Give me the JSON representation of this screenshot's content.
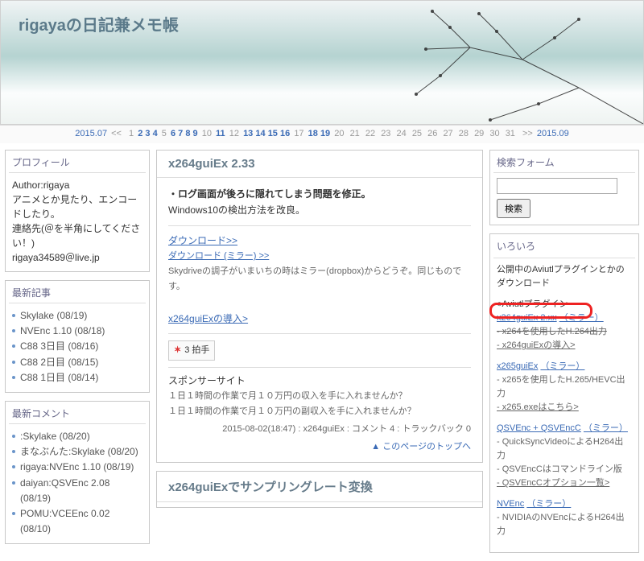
{
  "site_title": "rigayaの日記兼メモ帳",
  "calendar": {
    "prev": "2015.07",
    "next": "2015.09",
    "prev_sym": "<<",
    "next_sym": ">>",
    "days": [
      {
        "n": "1",
        "a": false
      },
      {
        "n": "2",
        "a": true
      },
      {
        "n": "3",
        "a": true
      },
      {
        "n": "4",
        "a": true
      },
      {
        "n": "5",
        "a": false
      },
      {
        "n": "6",
        "a": true
      },
      {
        "n": "7",
        "a": true
      },
      {
        "n": "8",
        "a": true
      },
      {
        "n": "9",
        "a": true
      },
      {
        "n": "10",
        "a": false
      },
      {
        "n": "11",
        "a": true
      },
      {
        "n": "12",
        "a": false
      },
      {
        "n": "13",
        "a": true
      },
      {
        "n": "14",
        "a": true
      },
      {
        "n": "15",
        "a": true
      },
      {
        "n": "16",
        "a": true
      },
      {
        "n": "17",
        "a": false
      },
      {
        "n": "18",
        "a": true
      },
      {
        "n": "19",
        "a": true
      },
      {
        "n": "20",
        "a": false
      },
      {
        "n": "21",
        "a": false
      },
      {
        "n": "22",
        "a": false
      },
      {
        "n": "23",
        "a": false
      },
      {
        "n": "24",
        "a": false
      },
      {
        "n": "25",
        "a": false
      },
      {
        "n": "26",
        "a": false
      },
      {
        "n": "27",
        "a": false
      },
      {
        "n": "28",
        "a": false
      },
      {
        "n": "29",
        "a": false
      },
      {
        "n": "30",
        "a": false
      },
      {
        "n": "31",
        "a": false
      }
    ]
  },
  "profile": {
    "heading": "プロフィール",
    "author_label": "Author:",
    "author": "rigaya",
    "line1": "アニメとか見たり、エンコードしたり。",
    "line2": "連絡先(＠を半角にしてください！)",
    "email": "rigaya34589＠live.jp"
  },
  "recent_posts": {
    "heading": "最新記事",
    "items": [
      "Skylake (08/19)",
      "NVEnc 1.10 (08/18)",
      "C88 3日目 (08/16)",
      "C88 2日目 (08/15)",
      "C88 1日目 (08/14)"
    ]
  },
  "recent_comments": {
    "heading": "最新コメント",
    "items": [
      ":Skylake (08/20)",
      "まなぶんた:Skylake (08/20)",
      "rigaya:NVEnc 1.10 (08/19)",
      "daiyan:QSVEnc 2.08 (08/19)",
      "POMU:VCEEnc 0.02 (08/10)"
    ]
  },
  "article": {
    "title": "x264guiEx 2.33",
    "p1": "・ログ画面が後ろに隠れてしまう問題を修正。",
    "p2": "Windows10の検出方法を改良。",
    "dl_head": "ダウンロード>>",
    "dl_mirror": "ダウンロード (ミラー) >>",
    "dl_note": "Skydriveの調子がいまいちの時はミラー(dropbox)からどうぞ。同じものです。",
    "intro_link": "x264guiExの導入>",
    "clap_count": "3 拍手",
    "sponsor_head": "スポンサーサイト",
    "sponsor_l1": "１日１時間の作業で月１０万円の収入を手に入れませんか？",
    "sponsor_l2": "１日１時間の作業で月１０万円の副収入を手に入れませんか？",
    "meta": "2015-08-02(18:47) : x264guiEx : コメント 4 : トラックバック 0",
    "toplink_sym": "▲",
    "toplink": "このページのトップへ"
  },
  "article2": {
    "title": "x264guiExでサンプリングレート変換"
  },
  "search": {
    "heading": "検索フォーム",
    "btn": "検索"
  },
  "iroiro": {
    "heading": "いろいろ",
    "intro": "公開中のAviutlプラグインとかのダウンロード",
    "row_del": "○Aviutlプラグイン",
    "row1a": "x264guiEx 2.xx",
    "row1b": "（ミラー）",
    "row1c": "- x264を使用したH.264出力",
    "row1d": "- x264guiExの導入>",
    "row2a": "x265guiEx",
    "row2b": "（ミラー）",
    "row2c": "- x265を使用したH.265/HEVC出力",
    "row2d": "- x265.exeはこちら>",
    "row3a": "QSVEnc + QSVEncC",
    "row3b": "（ミラー）",
    "row3c": "- QuickSyncVideoによるH264出力",
    "row3d": "- QSVEncCはコマンドライン版",
    "row3e": "- QSVEncCオプション一覧>",
    "row4a": "NVEnc",
    "row4b": "（ミラー）",
    "row4c": "- NVIDIAのNVEncによるH264出力"
  }
}
